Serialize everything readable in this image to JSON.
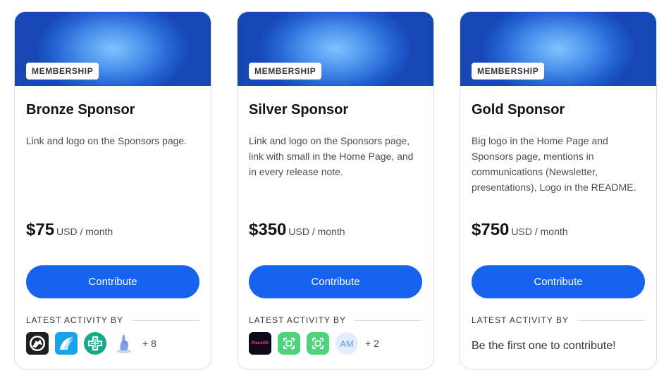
{
  "tiers": [
    {
      "badge": "MEMBERSHIP",
      "title": "Bronze Sponsor",
      "description": "Link and logo on the Sponsors page.",
      "price": "$75",
      "period": "USD / month",
      "button": "Contribute",
      "activity_label": "LATEST ACTIVITY BY",
      "more": "+ 8",
      "avatars": [
        "wolf-logo-avatar",
        "wave-logo-avatar",
        "cross-logo-avatar",
        "hand-avatar"
      ]
    },
    {
      "badge": "MEMBERSHIP",
      "title": "Silver Sponsor",
      "description": "Link and logo on the Sponsors page, link with small in the Home Page, and in every release note.",
      "price": "$350",
      "period": "USD / month",
      "button": "Contribute",
      "activity_label": "LATEST ACTIVITY BY",
      "more": "+ 2",
      "avatars": [
        "placeos-avatar",
        "green-frame-avatar",
        "green-frame-avatar",
        "am-initials-avatar"
      ],
      "placeos_text": "PlaceOS",
      "am_initials": "AM"
    },
    {
      "badge": "MEMBERSHIP",
      "title": "Gold Sponsor",
      "description": "Big logo in the Home Page and Sponsors page, mentions in communications (Newsletter, presentations), Logo in the README.",
      "price": "$750",
      "period": "USD / month",
      "button": "Contribute",
      "activity_label": "LATEST ACTIVITY BY",
      "empty_text": "Be the first one to contribute!"
    }
  ],
  "colors": {
    "accent": "#1563ee",
    "banner_light": "#7ec3ff",
    "banner_dark": "#1747b5"
  }
}
